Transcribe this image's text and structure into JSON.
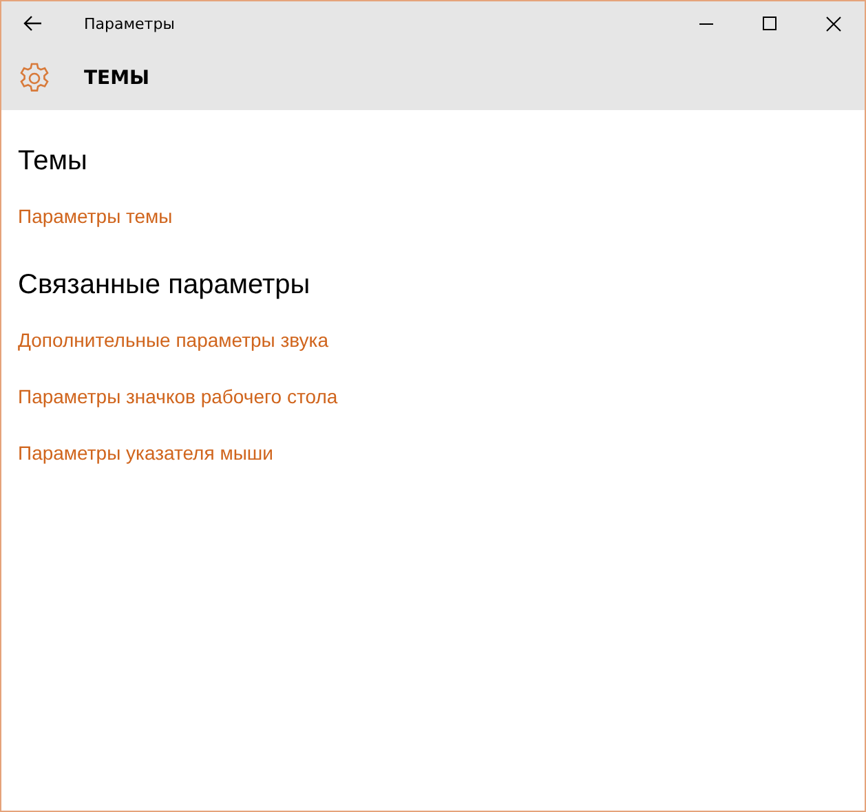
{
  "window": {
    "title": "Параметры"
  },
  "header": {
    "title": "ТЕМЫ"
  },
  "sections": [
    {
      "heading": "Темы",
      "links": [
        "Параметры темы"
      ]
    },
    {
      "heading": "Связанные параметры",
      "links": [
        "Дополнительные параметры звука",
        "Параметры значков рабочего стола",
        "Параметры указателя мыши"
      ]
    }
  ]
}
